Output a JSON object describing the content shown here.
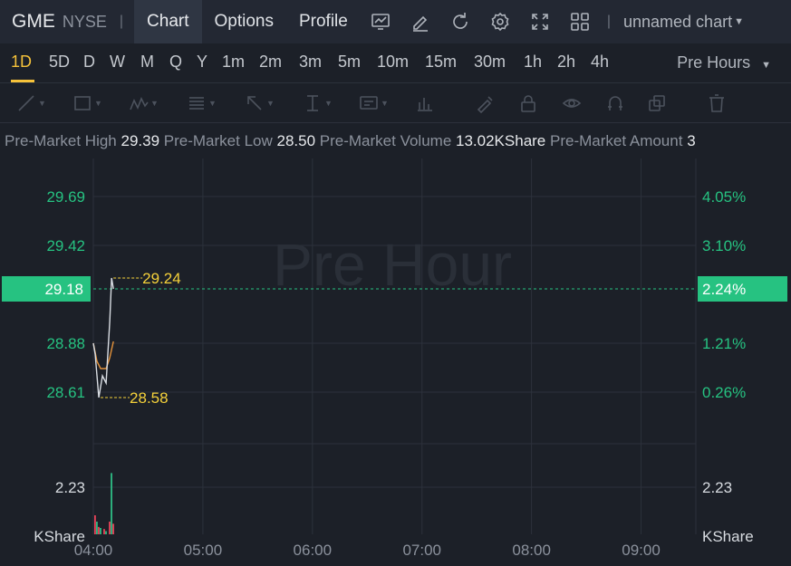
{
  "header": {
    "symbol": "GME",
    "exchange": "NYSE",
    "separator": "|",
    "tabs": [
      "Chart",
      "Options",
      "Profile"
    ],
    "active_tab": "Chart",
    "chart_name": "unnamed chart",
    "icons": [
      "indicator-icon",
      "draw-edit-icon",
      "refresh-icon",
      "settings-icon",
      "fullscreen-icon",
      "layout-grid-icon"
    ]
  },
  "timeframes": {
    "items": [
      "1D",
      "5D",
      "D",
      "W",
      "M",
      "Q",
      "Y",
      "1m",
      "2m",
      "3m",
      "5m",
      "10m",
      "15m",
      "30m",
      "1h",
      "2h",
      "4h"
    ],
    "active": "1D",
    "session_select": "Pre Hours"
  },
  "drawing_tools": [
    "trend-line-icon",
    "rectangle-icon",
    "pattern-icon",
    "fib-icon",
    "arrow-icon",
    "measure-icon",
    "text-note-icon",
    "chart-bars-icon",
    "brush-icon",
    "lock-icon",
    "eye-icon",
    "magnet-icon",
    "clone-icon",
    "trash-icon"
  ],
  "premarket": {
    "high_label": "Pre-Market High",
    "high_value": "29.39",
    "low_label": "Pre-Market Low",
    "low_value": "28.50",
    "volume_label": "Pre-Market Volume",
    "volume_value": "13.02KShare",
    "amount_label": "Pre-Market Amount",
    "amount_value": "3"
  },
  "chart_data": {
    "type": "line",
    "watermark": "Pre Hour",
    "x_ticks": [
      "04:00",
      "05:00",
      "06:00",
      "07:00",
      "08:00",
      "09:00"
    ],
    "price_ticks": [
      "29.69",
      "29.42",
      "28.88",
      "28.61"
    ],
    "percent_ticks": [
      "4.05%",
      "3.10%",
      "1.21%",
      "0.26%"
    ],
    "current_price": "29.18",
    "current_percent": "2.24%",
    "high_marker": "29.24",
    "low_marker": "28.58",
    "volume_tick": "2.23",
    "volume_unit": "KShare",
    "price_series": [
      {
        "t": "04:00",
        "v": 28.88
      },
      {
        "t": "04:01",
        "v": 28.82
      },
      {
        "t": "04:03",
        "v": 28.58
      },
      {
        "t": "04:05",
        "v": 28.7
      },
      {
        "t": "04:07",
        "v": 28.66
      },
      {
        "t": "04:09",
        "v": 29.0
      },
      {
        "t": "04:10",
        "v": 29.24
      },
      {
        "t": "04:11",
        "v": 29.18
      }
    ],
    "avg_series": [
      {
        "t": "04:00",
        "v": 28.88
      },
      {
        "t": "04:02",
        "v": 28.78
      },
      {
        "t": "04:04",
        "v": 28.74
      },
      {
        "t": "04:07",
        "v": 28.74
      },
      {
        "t": "04:09",
        "v": 28.8
      },
      {
        "t": "04:11",
        "v": 28.89
      }
    ],
    "volume_bars": [
      {
        "t": "04:00",
        "v": 0.9,
        "dir": "down"
      },
      {
        "t": "04:01",
        "v": 0.6,
        "dir": "up"
      },
      {
        "t": "04:02",
        "v": 0.35,
        "dir": "down"
      },
      {
        "t": "04:03",
        "v": 0.3,
        "dir": "up"
      },
      {
        "t": "04:05",
        "v": 0.25,
        "dir": "down"
      },
      {
        "t": "04:06",
        "v": 0.15,
        "dir": "up"
      },
      {
        "t": "04:08",
        "v": 0.6,
        "dir": "down"
      },
      {
        "t": "04:09",
        "v": 2.9,
        "dir": "up"
      },
      {
        "t": "04:10",
        "v": 0.5,
        "dir": "down"
      }
    ],
    "colors": {
      "up": "#2ebd85",
      "down": "#e94359",
      "price_line": "#d9dde3",
      "avg_line": "#e2913a",
      "marker": "#f6d23a",
      "accent": "#26c281"
    }
  }
}
